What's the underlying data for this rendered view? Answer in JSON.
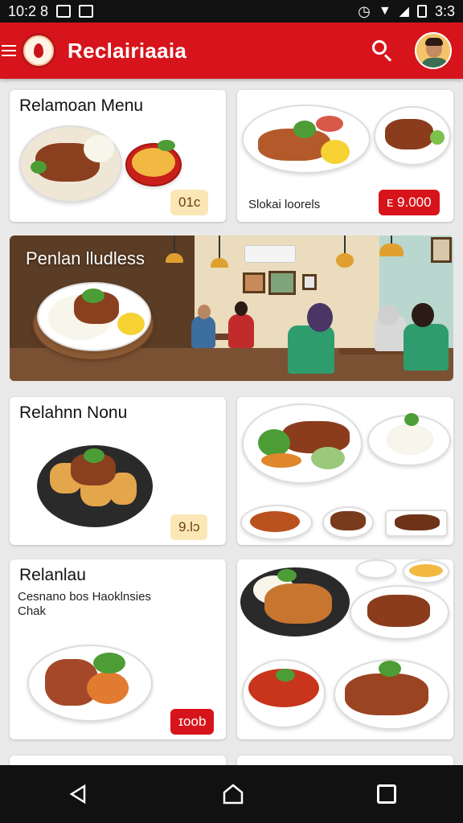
{
  "status_bar": {
    "time": "10:2 8",
    "battery": "3:3"
  },
  "app_bar": {
    "title": "Reclairiaaia",
    "logo_icon": "restaurant-logo-icon",
    "search_icon": "search-icon",
    "avatar_icon": "user-avatar-icon",
    "accent_color": "#d7141b"
  },
  "cards": [
    {
      "title": "Relamoan Menu",
      "price": "01ᴄ",
      "price_style": "yellow"
    },
    {
      "subtitle": "Slokai loorels",
      "price": "ᴇ 9.000",
      "price_style": "red"
    },
    {
      "title": "Relahnn Nonu",
      "price": "9.lɔ",
      "price_style": "yellow"
    },
    {
      "title": "Relanlau",
      "subtitle": "Cesnano bos Haoklnsies\nChak",
      "price": "ɪoob",
      "price_style": "red"
    }
  ],
  "banner": {
    "title": "Penlan lludless"
  },
  "nav_bar": {
    "back_icon": "back-triangle-icon",
    "home_icon": "home-icon",
    "recents_icon": "recents-square-icon"
  }
}
